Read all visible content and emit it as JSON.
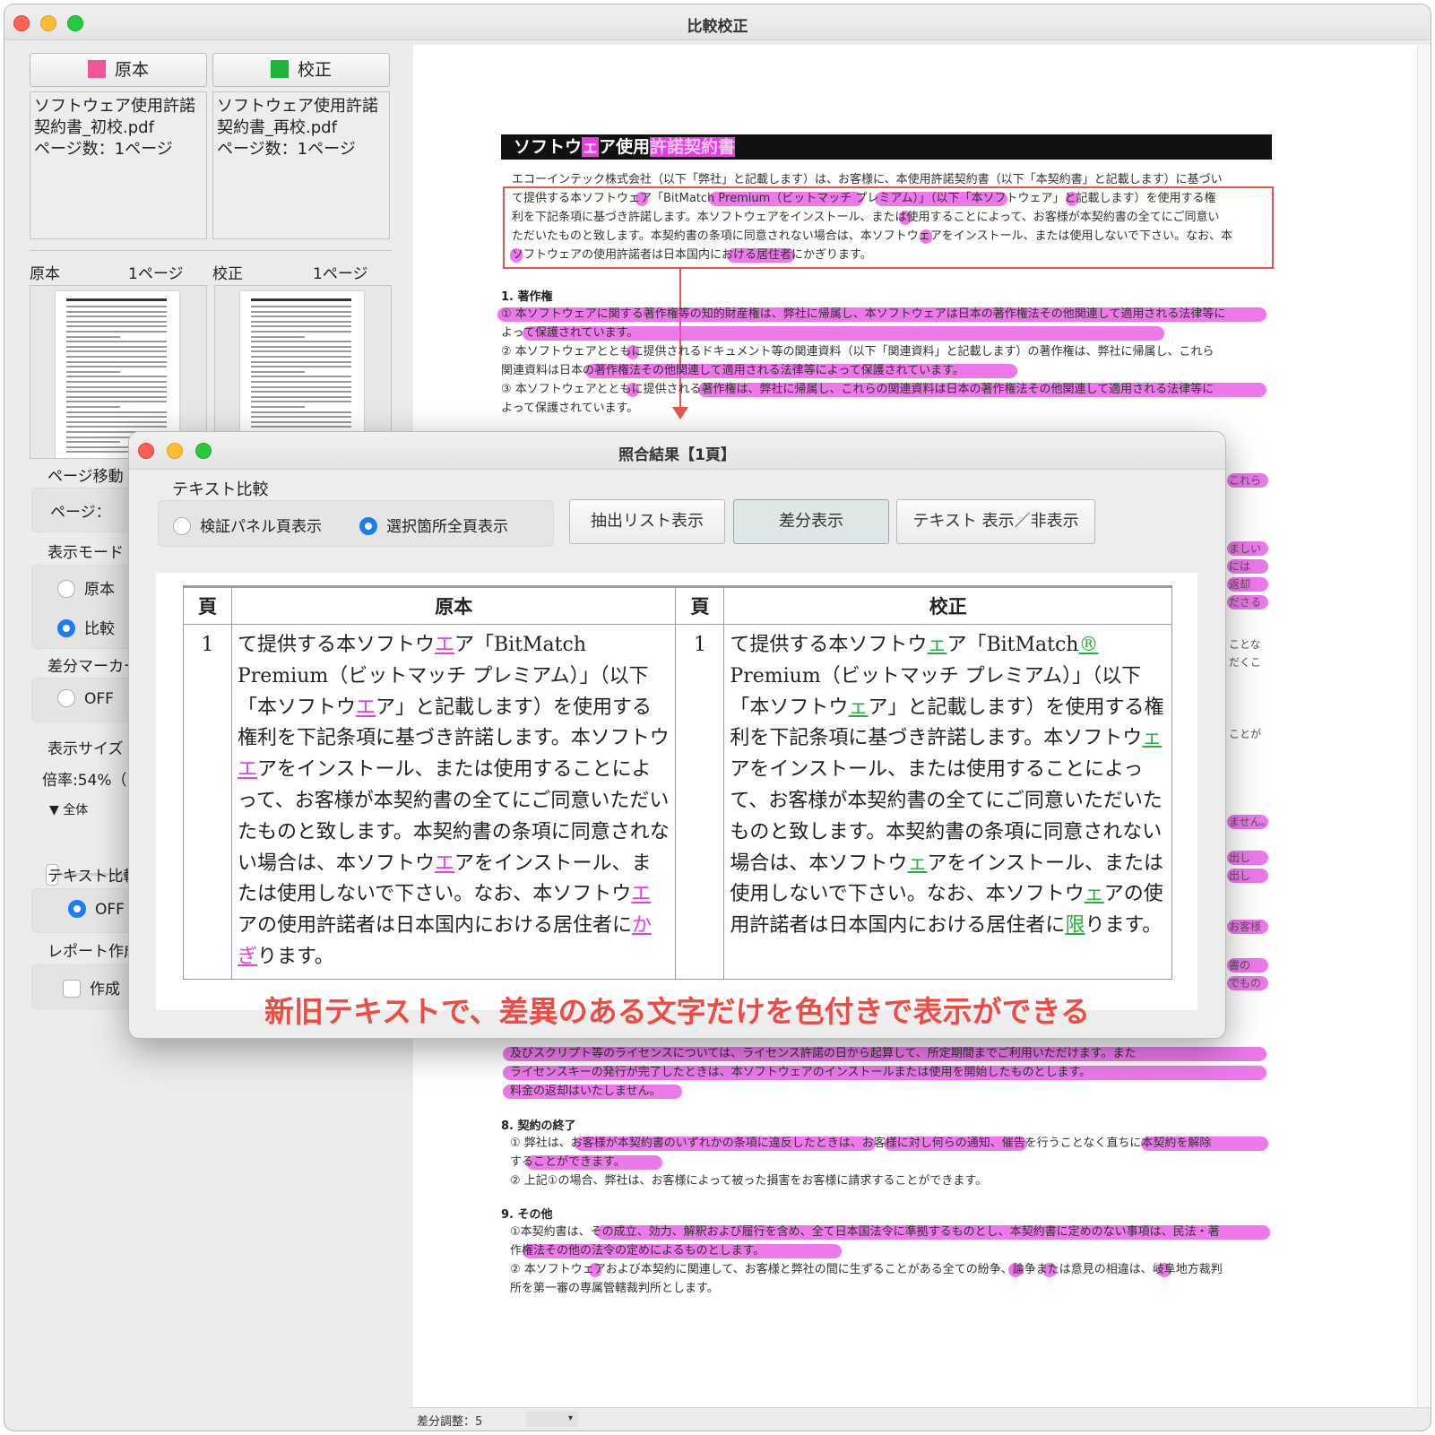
{
  "window": {
    "title": "比較校正"
  },
  "left": {
    "original_tab": {
      "label": "原本",
      "color": "#f0569a"
    },
    "revised_tab": {
      "label": "校正",
      "color": "#1fb43b"
    },
    "original_info": {
      "line1": "ソフトウェア使用許諾",
      "line2": "契約書_初校.pdf",
      "line3": "ページ数：1ページ"
    },
    "revised_info": {
      "line1": "ソフトウェア使用許諾",
      "line2": "契約書_再校.pdf",
      "line3": "ページ数：1ページ"
    },
    "original_pages": {
      "label": "原本",
      "count": "1ページ"
    },
    "revised_pages": {
      "label": "校正",
      "count": "1ページ"
    },
    "page_move": {
      "label": "ページ移動",
      "page_label": "ページ："
    },
    "display_mode": {
      "label": "表示モード",
      "option1": "原本",
      "option2": "比較"
    },
    "diff_marker": {
      "label": "差分マーカー",
      "option": "OFF"
    },
    "display_size": {
      "label": "表示サイズ",
      "zoom": "倍率:54%（",
      "fit": "▼ 全体"
    },
    "text_compare": {
      "label": "テキスト比較",
      "option": "OFF"
    },
    "report": {
      "label": "レポート作成",
      "option": "作成"
    }
  },
  "doc": {
    "title_a": "ソフトウ",
    "title_b": "ェ",
    "title_c": "ア使用",
    "title_d": "許諾契約書",
    "para_lines": [
      "エコーインテック株式会社（以下「弊社」と記載します）は、お客様に、本使用許諾契約書（以下「本契約書」と記載します）に基づい",
      "て提供する本ソフトウェア「BitMatch Premium（ビットマッチ プレミアム）」（以下「本ソフトウェア」と記載します）を使用する権",
      "利を下記条項に基づき許諾します。本ソフトウェアをインストール、または使用することによって、お客様が本契約書の全てにご同意い",
      "ただいたものと致します。本契約書の条項に同意されない場合は、本ソフトウェアをインストール、または使用しないで下さい。なお、本",
      "ソフトウェアの使用許諾者は日本国内における居住者にかぎります。"
    ],
    "sec1": "1. 著作権",
    "sec1_lines": [
      "① 本ソフトウェアに関する著作権等の知的財産権は、弊社に帰属し、本ソフトウェアは日本の著作権法その他関連して適用される法律等に",
      "よって保護されています。",
      "② 本ソフトウェアとともに提供されるドキュメント等の関連資料（以下「関連資料」と記載します）の著作権は、弊社に帰属し、これら",
      "関連資料は日本の著作権法その他関連して適用される法律等によって保護されています。",
      "③ 本ソフトウェアとともに提供される著作権は、弊社に帰属し、これらの関連資料は日本の著作権法その他関連して適用される法律等に",
      "よって保護されています。"
    ],
    "side_fragments": [
      "これら",
      "ましい",
      "には",
      "返却",
      "ださる",
      "ことな",
      "だくこ",
      "ことが",
      "ません。",
      "出し",
      "出し",
      "お客様",
      "書の",
      "でもの"
    ],
    "lower_lines": [
      "及びスクリプト等のライセンスについては、ライセンス許諾の日から起算して、所定期間までご利用いただけます。また",
      "ライセンスキーの発行が完了したときは、本ソフトウェアのインストールまたは使用を開始したものとします。",
      "料金の返却はいたしません。"
    ],
    "sec8": "8. 契約の終了",
    "sec8_lines": [
      "① 弊社は、お客様が本契約書のいずれかの条項に違反したときは、お客様に対し何らの通知、催告を行うことなく直ちに本契約を解除",
      "することができます。",
      "② 上記①の場合、弊社は、お客様によって被った損害をお客様に請求することができます。"
    ],
    "sec9": "9. その他",
    "sec9_lines": [
      "①本契約書は、その成立、効力、解釈および履行を含め、全て日本国法令に準拠するものとし、本契約書に定めのない事項は、民法・著",
      "作権法その他の法令の定めによるものとします。",
      "② 本ソフトウェアおよび本契約に関連して、お客様と弊社の間に生ずることがある全ての紛争、論争または意見の相違は、岐阜地方裁判",
      "所を第一審の専属管轄裁判所とします。"
    ],
    "status_label": "差分調整：5",
    "status_drop": "▾"
  },
  "dialog": {
    "title": "照合結果【1頁】",
    "group_label": "テキスト比較",
    "radio1": "検証パネル頁表示",
    "radio2": "選択箇所全頁表示",
    "btn_extract": "抽出リスト表示",
    "btn_diff": "差分表示",
    "btn_text": "テキスト 表示／非表示",
    "table": {
      "h_page1": "頁",
      "h_original": "原本",
      "h_page2": "頁",
      "h_revised": "校正",
      "page_original": "1",
      "page_revised": "1"
    },
    "original_text": [
      {
        "t": "て提供する本ソフトウ"
      },
      {
        "t": "エ",
        "d": 1
      },
      {
        "t": "ア「BitMatch Premium（ビットマッチ プレミアム）」（以下「本ソフトウ"
      },
      {
        "t": "エ",
        "d": 1
      },
      {
        "t": "ア」と記載します）を使用する権利を下記条項に基づき許諾します。本ソフトウ"
      },
      {
        "t": "エ",
        "d": 1
      },
      {
        "t": "アをインストール、または使用することによって、お客様が本契約書の全てにご同意いただいたものと致します。本契約書の条項に同意されない場合は、本ソフトウ"
      },
      {
        "t": "エ",
        "d": 1
      },
      {
        "t": "アをインストール、または使用しないで下さい。なお、本ソフトウ"
      },
      {
        "t": "エ",
        "d": 1
      },
      {
        "t": "アの使用許諾者は日本国内における居住者に"
      },
      {
        "t": "かぎ",
        "d": 1
      },
      {
        "t": "ります。"
      }
    ],
    "revised_text": [
      {
        "t": "て提供する本ソフトウ"
      },
      {
        "t": "ェ",
        "d": 1
      },
      {
        "t": "ア「BitMatch"
      },
      {
        "t": "®",
        "d": 1
      },
      {
        "t": " Premium（ビットマッチ プレミアム）」（以下「本ソフトウ"
      },
      {
        "t": "ェ",
        "d": 1
      },
      {
        "t": "ア」と記載します）を使用する権利を下記条項に基づき許諾します。本ソフトウ"
      },
      {
        "t": "ェ",
        "d": 1
      },
      {
        "t": "アをインストール、または使用することによって、お客様が本契約書の全てにご同意いただいたものと致します。本契約書の条項に同意されない場合は、本ソフトウ"
      },
      {
        "t": "ェ",
        "d": 1
      },
      {
        "t": "アをインストール、または使用しないで下さい。なお、本ソフトウ"
      },
      {
        "t": "ェ",
        "d": 1
      },
      {
        "t": "アの使用許諾者は日本国内における居住者に"
      },
      {
        "t": "限",
        "d": 1
      },
      {
        "t": "ります。"
      }
    ],
    "caption": "新旧テキストで、差異のある文字だけを色付きで表示ができる"
  }
}
